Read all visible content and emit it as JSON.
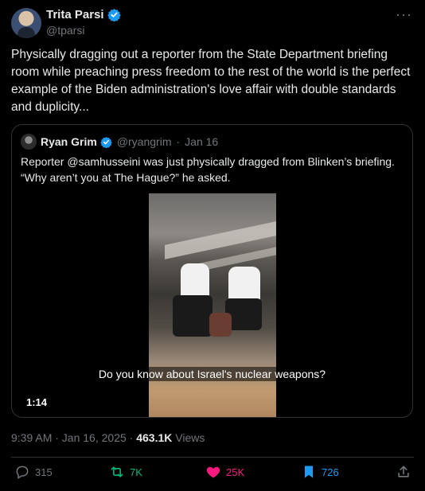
{
  "author": {
    "name": "Trita Parsi",
    "handle": "@tparsi"
  },
  "more_label": "···",
  "post_text": "Physically dragging out a reporter from the State Department briefing room while preaching press freedom to the rest of the world is the perfect example of the Biden administration's love affair with double standards and duplicity...",
  "quoted": {
    "name": "Ryan Grim",
    "handle": "@ryangrim",
    "separator": "·",
    "date": "Jan 16",
    "text": "Reporter @samhusseini was just physically dragged from Blinken’s briefing. “Why aren’t you at The Hague?” he asked.",
    "video": {
      "caption": "Do you know about Israel's nuclear weapons?",
      "duration": "1:14"
    }
  },
  "meta": {
    "time": "9:39 AM · Jan 16, 2025 · ",
    "views_count": "463.1K",
    "views_label": " Views"
  },
  "actions": {
    "replies": "315",
    "reposts": "7K",
    "likes": "25K",
    "bookmarks": "726"
  },
  "colors": {
    "background": "#000000",
    "text": "#e7e9ea",
    "secondary": "#71767b",
    "verified": "#1d9bf0",
    "repost": "#00ba7c",
    "like": "#f91880",
    "bookmark": "#1d9bf0",
    "border": "#2f3336"
  },
  "icons": {
    "verified": "verified-badge-icon",
    "reply": "reply-icon",
    "repost": "repost-icon",
    "like": "heart-icon",
    "bookmark": "bookmark-icon",
    "share": "share-icon"
  }
}
